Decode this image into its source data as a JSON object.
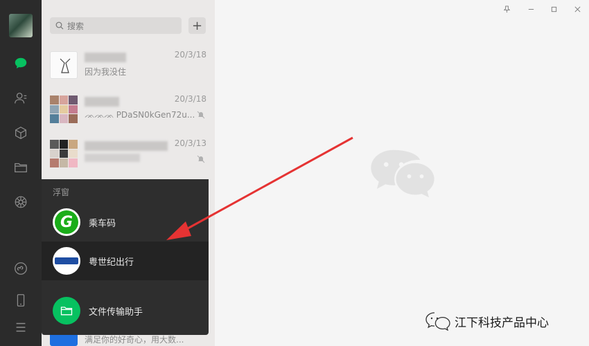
{
  "search": {
    "placeholder": "搜索"
  },
  "chats": [
    {
      "time": "20/3/18",
      "preview": "因为我没住"
    },
    {
      "time": "20/3/18",
      "preview": "PDaSN0kGen72u..."
    },
    {
      "time": "20/3/13",
      "preview": ""
    }
  ],
  "float_panel": {
    "header": "浮窗",
    "items": [
      {
        "label": "乘车码"
      },
      {
        "label": "粤世纪出行"
      },
      {
        "label": "文件传输助手"
      }
    ]
  },
  "partial_preview": "满足你的好奇心，用大数...",
  "watermark": "江下科技产品中心",
  "colors": {
    "accent": "#07c160",
    "rail": "#2b2b2b",
    "panel": "#2e2e2e",
    "arrow": "#e53333"
  }
}
